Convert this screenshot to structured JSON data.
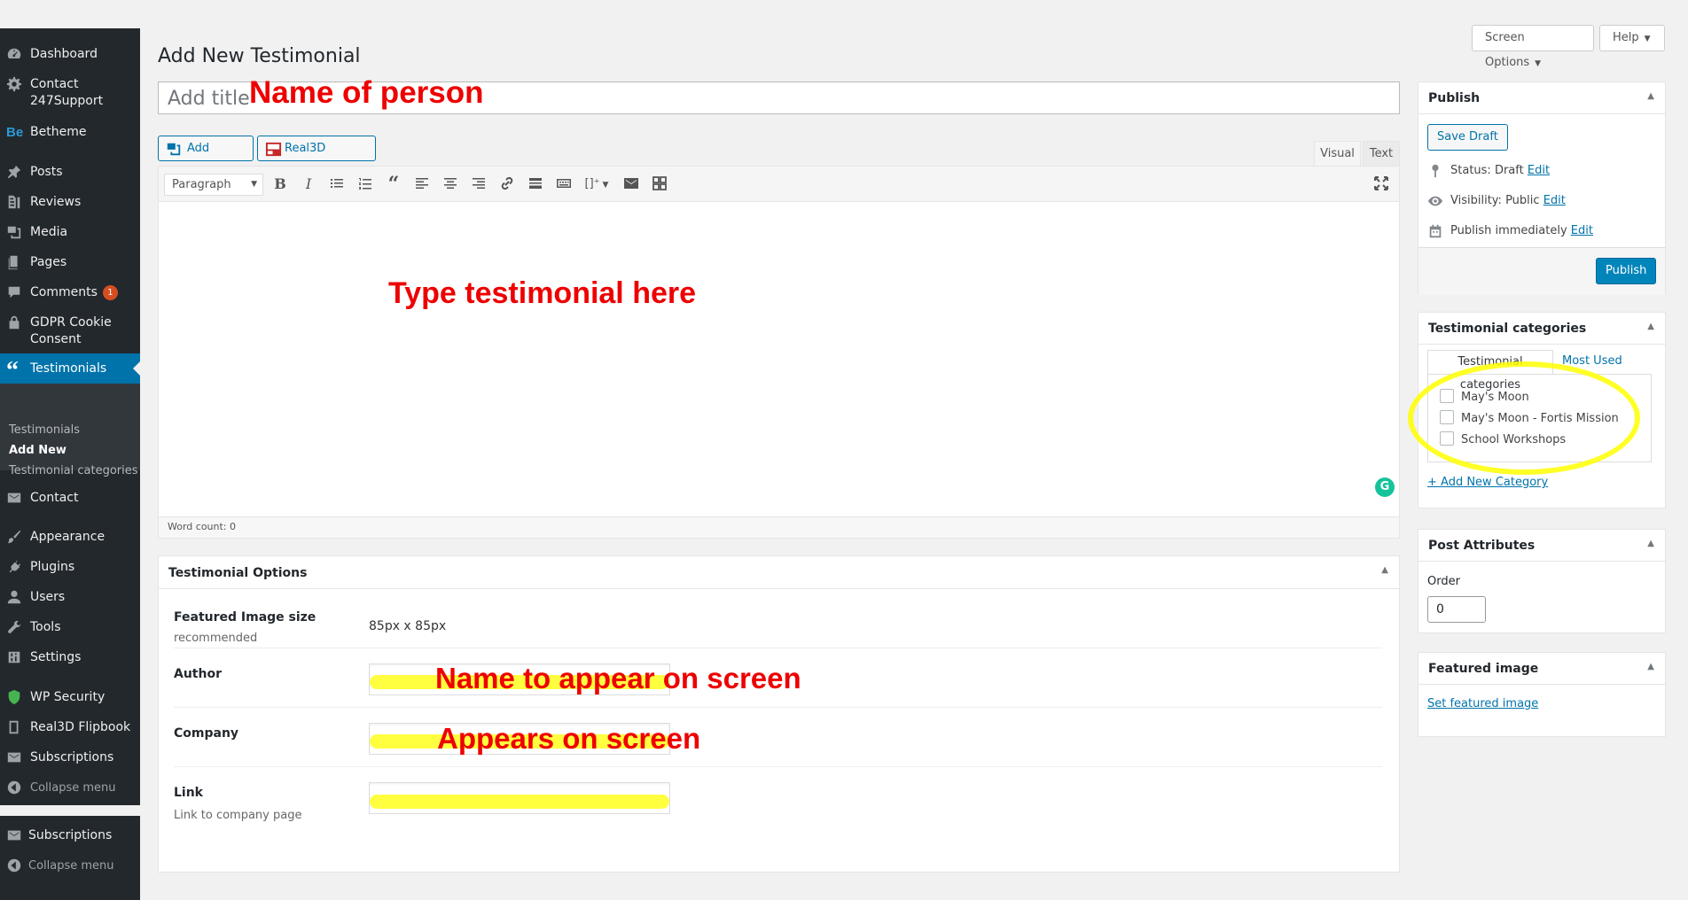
{
  "sidebar": {
    "items": [
      {
        "label": "Dashboard",
        "icon": "dashboard-icon"
      },
      {
        "label": "Contact 247Support",
        "icon": "gear-icon"
      },
      {
        "label": "Betheme",
        "icon": "betheme-logo-icon"
      },
      {
        "label": "Posts",
        "icon": "pin-icon"
      },
      {
        "label": "Reviews",
        "icon": "reviews-icon"
      },
      {
        "label": "Media",
        "icon": "media-icon"
      },
      {
        "label": "Pages",
        "icon": "pages-icon"
      },
      {
        "label": "Comments",
        "icon": "comment-icon",
        "badge": "1"
      },
      {
        "label": "GDPR Cookie Consent",
        "icon": "lock-icon"
      },
      {
        "label": "Testimonials",
        "icon": "quote-icon"
      },
      {
        "label": "Contact",
        "icon": "mail-icon"
      },
      {
        "label": "Appearance",
        "icon": "brush-icon"
      },
      {
        "label": "Plugins",
        "icon": "plug-icon"
      },
      {
        "label": "Users",
        "icon": "user-icon"
      },
      {
        "label": "Tools",
        "icon": "wrench-icon"
      },
      {
        "label": "Settings",
        "icon": "settings-icon"
      },
      {
        "label": "WP Security",
        "icon": "shield-icon"
      },
      {
        "label": "Real3D Flipbook",
        "icon": "book-icon"
      },
      {
        "label": "Subscriptions",
        "icon": "mail-icon"
      },
      {
        "label": "Collapse menu",
        "icon": "collapse-icon"
      },
      {
        "label": "Subscriptions",
        "icon": "mail-icon"
      },
      {
        "label": "Collapse menu",
        "icon": "collapse-icon"
      }
    ],
    "submenu": [
      "Testimonials",
      "Add New",
      "Testimonial categories"
    ],
    "comment_badge": "1"
  },
  "top": {
    "screen_options": "Screen Options",
    "help": "Help"
  },
  "page": {
    "title": "Add New Testimonial",
    "title_placeholder": "Add title"
  },
  "annotations": {
    "title_note": "Name of person",
    "body_note": "Type testimonial here",
    "author_note": "Name to appear on screen",
    "company_note": "Appears on screen",
    "color": "#e00000",
    "highlight_color": "#ffff00"
  },
  "editor": {
    "add_media": "Add Media",
    "flipbook": "Real3D Flipbook",
    "tab_visual": "Visual",
    "tab_text": "Text",
    "format": "Paragraph",
    "word_count": "Word count: 0"
  },
  "options": {
    "title": "Testimonial Options",
    "image_size_label": "Featured Image size",
    "image_size_desc": "recommended",
    "image_size_value": "85px x 85px",
    "author_label": "Author",
    "company_label": "Company",
    "link_label": "Link",
    "link_desc": "Link to company page"
  },
  "publish": {
    "title": "Publish",
    "save_draft": "Save Draft",
    "status_label": "Status:",
    "status_value": "Draft",
    "visibility_label": "Visibility:",
    "visibility_value": "Public",
    "schedule_label": "Publish",
    "schedule_value": "immediately",
    "edit": "Edit",
    "publish_button": "Publish"
  },
  "categories": {
    "title": "Testimonial categories",
    "tab_all": "Testimonial categories",
    "tab_most_used": "Most Used",
    "items": [
      "May's Moon",
      "May's Moon - Fortis Mission",
      "School Workshops"
    ],
    "add_new": "+ Add New Category"
  },
  "attributes": {
    "title": "Post Attributes",
    "order_label": "Order",
    "order_value": "0"
  },
  "featured": {
    "title": "Featured image",
    "set_link": "Set featured image"
  },
  "colors": {
    "sidebar_bg": "#23282d",
    "active_bg": "#0073aa",
    "primary": "#0073aa",
    "background": "#f1f1f1"
  }
}
